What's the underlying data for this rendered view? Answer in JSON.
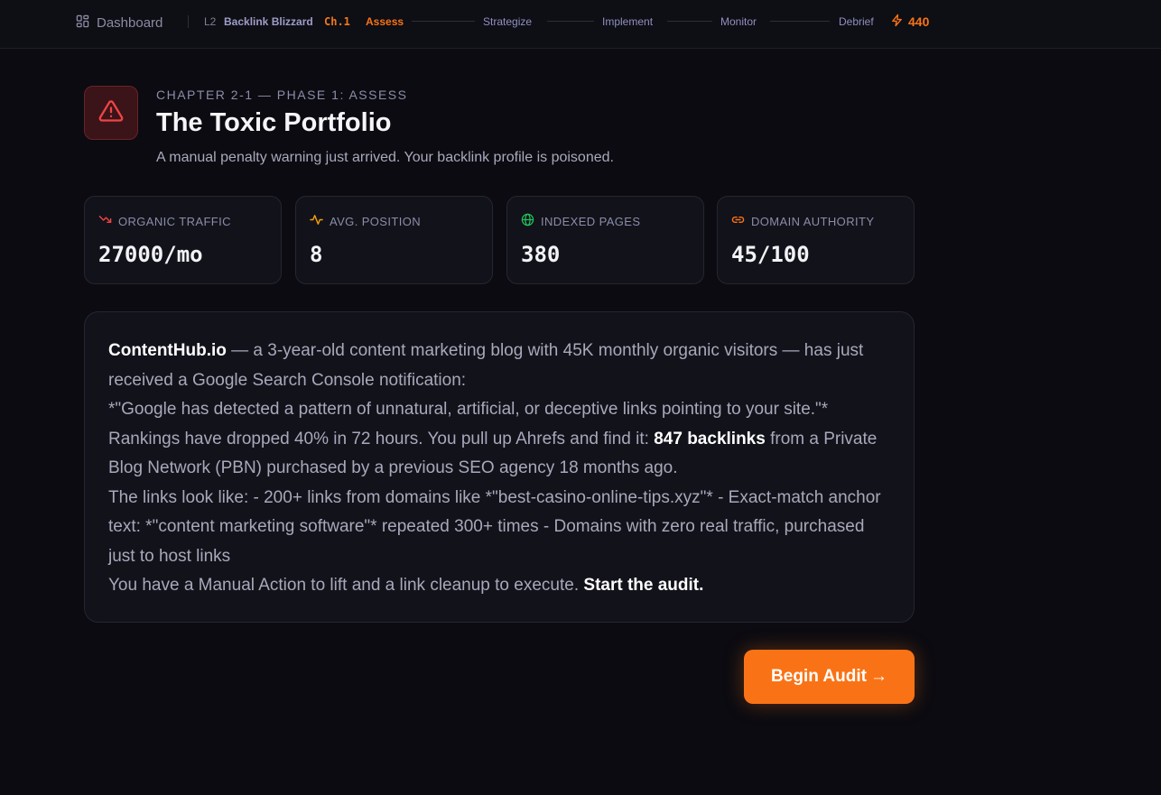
{
  "nav": {
    "dashboard_label": "Dashboard",
    "level": "L2",
    "course": "Backlink Blizzard",
    "chapter": "Ch.1",
    "steps": [
      "Assess",
      "Strategize",
      "Implement",
      "Monitor",
      "Debrief"
    ],
    "active_step": "Assess",
    "xp": "440"
  },
  "header": {
    "eyebrow": "CHAPTER 2-1 — PHASE 1: ASSESS",
    "title": "The Toxic Portfolio",
    "subtitle": "A manual penalty warning just arrived. Your backlink profile is poisoned."
  },
  "stats": [
    {
      "label": "ORGANIC TRAFFIC",
      "value": "27000/mo",
      "icon": "trending-down-icon",
      "color": "#ef4444"
    },
    {
      "label": "AVG. POSITION",
      "value": "8",
      "icon": "activity-icon",
      "color": "#f59e0b"
    },
    {
      "label": "INDEXED PAGES",
      "value": "380",
      "icon": "globe-icon",
      "color": "#22c55e"
    },
    {
      "label": "DOMAIN AUTHORITY",
      "value": "45/100",
      "icon": "link-icon",
      "color": "#f97316"
    }
  ],
  "story": {
    "p1_strong": "ContentHub.io",
    "p1_rest": " — a 3-year-old content marketing blog with 45K monthly organic visitors — has just received a Google Search Console notification:",
    "p2": "*\"Google has detected a pattern of unnatural, artificial, or deceptive links pointing to your site.\"*",
    "p3_a": "Rankings have dropped 40% in 72 hours. You pull up Ahrefs and find it: ",
    "p3_strong": "847 backlinks",
    "p3_b": " from a Private Blog Network (PBN) purchased by a previous SEO agency 18 months ago.",
    "p4": "The links look like: - 200+ links from domains like *\"best-casino-online-tips.xyz\"* - Exact-match anchor text: *\"content marketing software\"* repeated 300+ times - Domains with zero real traffic, purchased just to host links",
    "p5_a": "You have a Manual Action to lift and a link cleanup to execute. ",
    "p5_strong": "Start the audit."
  },
  "cta": {
    "label": "Begin Audit",
    "arrow": "→"
  },
  "colors": {
    "accent": "#f97316",
    "danger": "#ef4444",
    "background": "#0b0b11",
    "card": "#12121a"
  }
}
